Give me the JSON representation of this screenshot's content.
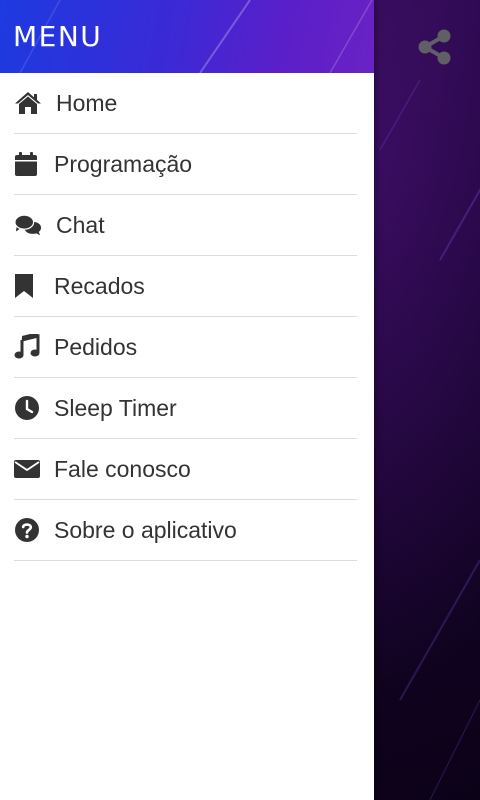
{
  "drawer": {
    "title": "MENU"
  },
  "menu": [
    {
      "label": "Home",
      "icon": "home-icon"
    },
    {
      "label": "Programação",
      "icon": "calendar-icon"
    },
    {
      "label": "Chat",
      "icon": "chat-icon"
    },
    {
      "label": "Recados",
      "icon": "bookmark-icon"
    },
    {
      "label": "Pedidos",
      "icon": "music-note-icon"
    },
    {
      "label": "Sleep Timer",
      "icon": "clock-icon"
    },
    {
      "label": "Fale conosco",
      "icon": "envelope-icon"
    },
    {
      "label": "Sobre o aplicativo",
      "icon": "question-circle-icon"
    }
  ],
  "header_actions": {
    "share_icon": "share-icon"
  },
  "colors": {
    "header_gradient_start": "#1d3ae0",
    "header_gradient_end": "#6a22c4",
    "icon_color": "#333333",
    "text_color": "#333333",
    "divider_color": "#dcdcdc",
    "backdrop": "#120321"
  }
}
